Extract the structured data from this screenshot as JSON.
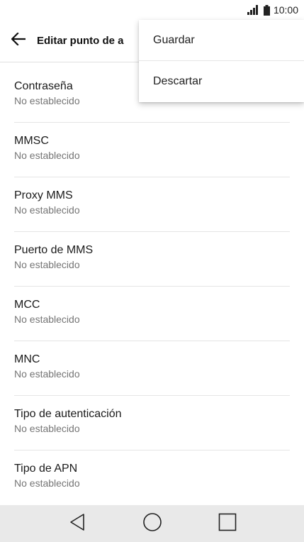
{
  "status_bar": {
    "time": "10:00",
    "signal_icon": "signal-bars-icon",
    "battery_icon": "battery-icon"
  },
  "app_bar": {
    "back_icon": "arrow-left-icon",
    "title": "Editar punto de a"
  },
  "menu": {
    "items": [
      {
        "label": "Guardar"
      },
      {
        "label": "Descartar"
      }
    ]
  },
  "settings": {
    "items": [
      {
        "title": "Contraseña",
        "value": "No establecido"
      },
      {
        "title": "MMSC",
        "value": "No establecido"
      },
      {
        "title": "Proxy MMS",
        "value": "No establecido"
      },
      {
        "title": "Puerto de MMS",
        "value": "No establecido"
      },
      {
        "title": "MCC",
        "value": "No establecido"
      },
      {
        "title": "MNC",
        "value": "No establecido"
      },
      {
        "title": "Tipo de autenticación",
        "value": "No establecido"
      },
      {
        "title": "Tipo de APN",
        "value": "No establecido"
      }
    ]
  },
  "nav_bar": {
    "back_icon": "triangle-back-icon",
    "home_icon": "circle-home-icon",
    "recents_icon": "square-recents-icon",
    "background": "#e9e9e9"
  }
}
